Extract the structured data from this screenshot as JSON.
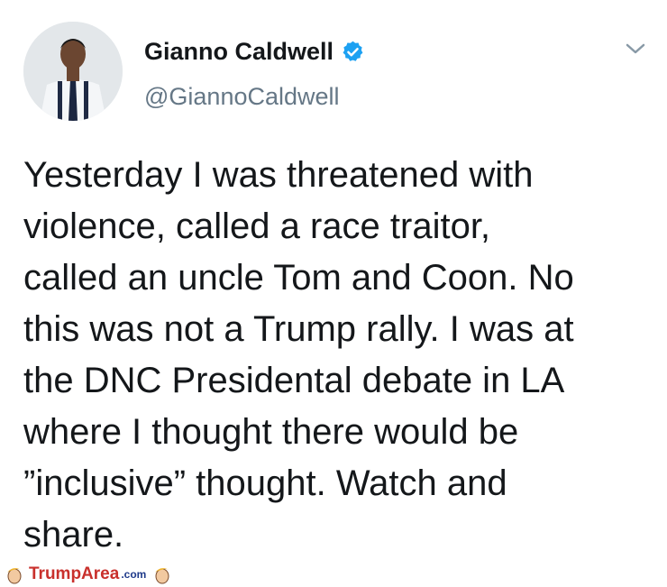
{
  "tweet": {
    "author_name": "Gianno Caldwell",
    "author_handle": "@GiannoCaldwell",
    "verified": true,
    "text": "Yesterday I was threatened with\nviolence, called a race traitor,\ncalled an uncle Tom and Coon. No\nthis was not a Trump rally. I was at\nthe DNC Presidental debate in LA\nwhere I thought there would be\n”inclusive” thought. Watch and\nshare."
  },
  "watermark": {
    "brand": "TrumpArea",
    "suffix": ".com"
  },
  "colors": {
    "verified_badge": "#1da1f2",
    "handle_text": "#657786",
    "watermark_red": "#c9302c",
    "watermark_blue": "#1f3a8a"
  },
  "icons": {
    "verified": "verified-badge-icon",
    "menu": "chevron-down-icon",
    "watermark_face": "trump-face-icon"
  }
}
